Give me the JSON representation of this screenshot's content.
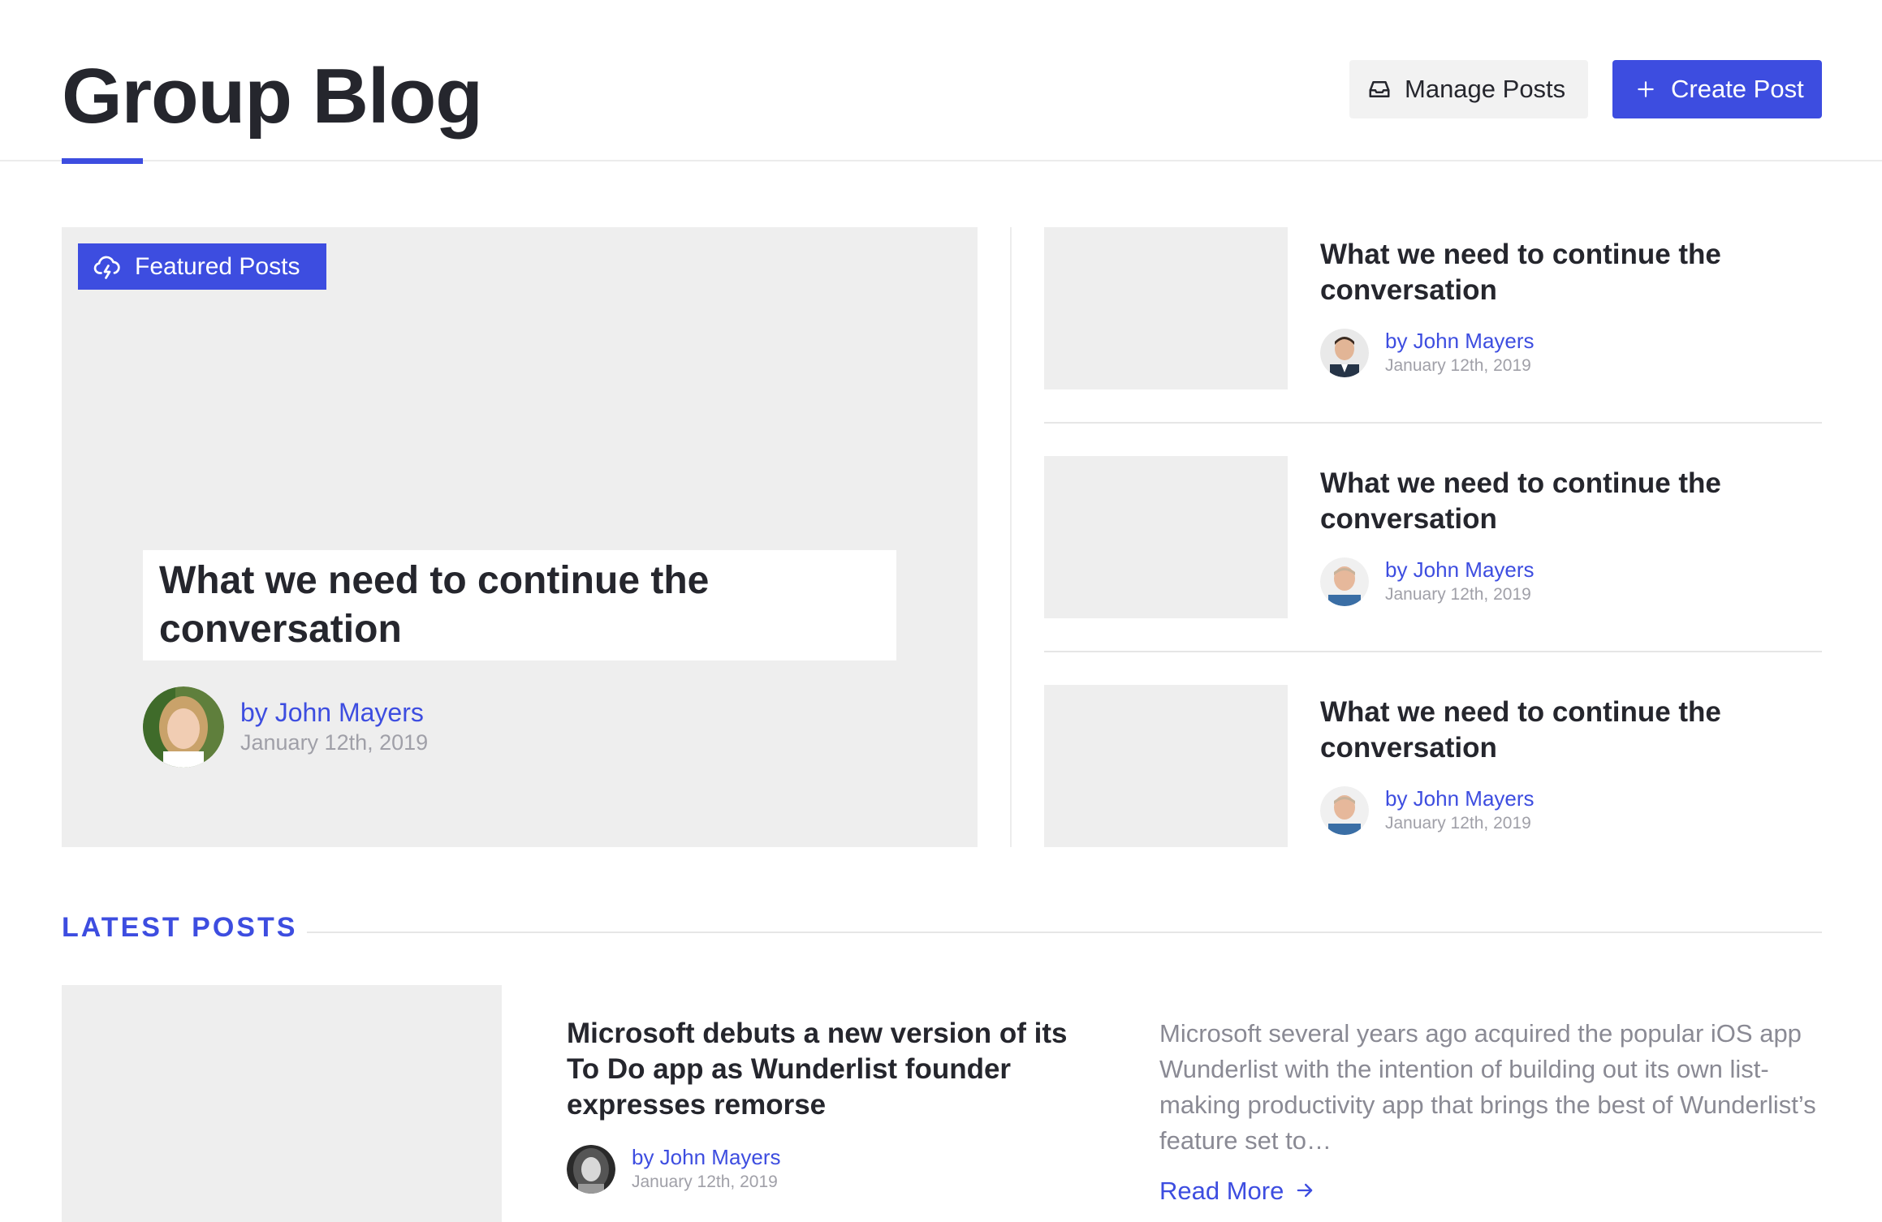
{
  "header": {
    "title": "Group Blog",
    "manage_label": "Manage Posts",
    "create_label": "Create Post",
    "accent_color": "#3d4de0"
  },
  "featured": {
    "badge_label": "Featured Posts",
    "badge_icon": "cloud-lightning-icon",
    "title": "What we need to continue the conversation",
    "author": "by John Mayers",
    "date": "January 12th, 2019"
  },
  "side_posts": [
    {
      "title": "What we need to continue the conversation",
      "author": "by John Mayers",
      "date": "January 12th, 2019"
    },
    {
      "title": "What we need to continue the conversation",
      "author": "by John Mayers",
      "date": "January 12th, 2019"
    },
    {
      "title": "What we need to continue the conversation",
      "author": "by John Mayers",
      "date": "January 12th, 2019"
    }
  ],
  "latest": {
    "heading": "LATEST POSTS",
    "post": {
      "title": "Microsoft debuts a new version of its To Do app as Wunderlist founder expresses remorse",
      "author": "by John Mayers",
      "date": "January 12th, 2019",
      "excerpt": "Microsoft several years ago acquired the popular iOS app Wunderlist with the intention of building out its own list-making productivity app that brings the best of Wunderlist’s feature set to…",
      "read_more": "Read More"
    }
  }
}
